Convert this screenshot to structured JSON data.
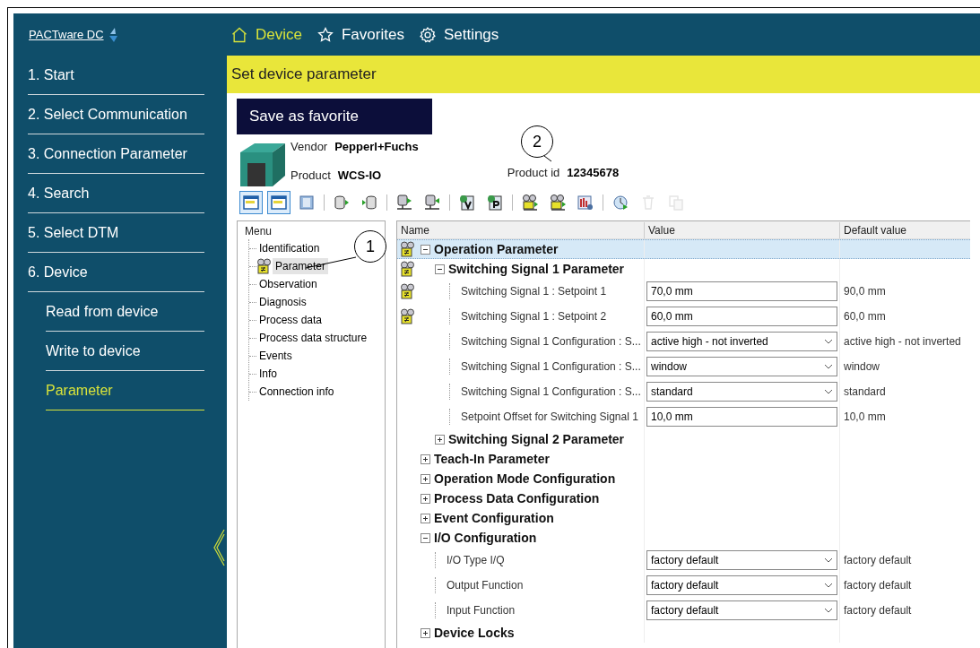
{
  "logo": {
    "text": "PACTware DC"
  },
  "top_nav": [
    {
      "kind": "home",
      "label": "Device",
      "selected": true
    },
    {
      "kind": "star",
      "label": "Favorites",
      "selected": false
    },
    {
      "kind": "gear",
      "label": "Settings",
      "selected": false
    }
  ],
  "sidebar": {
    "items": [
      {
        "label": "1. Start",
        "selected": false
      },
      {
        "label": "2. Select Communication",
        "selected": false
      },
      {
        "label": "3. Connection Parameter",
        "selected": false
      },
      {
        "label": "4. Search",
        "selected": false
      },
      {
        "label": "5. Select DTM",
        "selected": false
      },
      {
        "label": "6. Device",
        "selected": false,
        "children": [
          {
            "label": "Read from device",
            "selected": false
          },
          {
            "label": "Write to device",
            "selected": false
          },
          {
            "label": "Parameter",
            "selected": true
          }
        ]
      }
    ]
  },
  "page_title": "Set device parameter",
  "save_button": "Save as favorite",
  "device": {
    "vendor_label": "Vendor",
    "vendor": "Pepperl+Fuchs",
    "product_label": "Product",
    "product": "WCS-IO",
    "product_id_label": "Product id",
    "product_id": "12345678"
  },
  "toolbar": [
    {
      "kind": "window",
      "selected": true,
      "disabled": false
    },
    {
      "kind": "window",
      "selected": true,
      "disabled": false
    },
    {
      "kind": "panel",
      "selected": false,
      "disabled": false
    },
    {
      "kind": "separator"
    },
    {
      "kind": "db-out",
      "selected": false,
      "disabled": false
    },
    {
      "kind": "db-in",
      "selected": false,
      "disabled": false
    },
    {
      "kind": "separator"
    },
    {
      "kind": "device-out",
      "selected": false,
      "disabled": false
    },
    {
      "kind": "device-in",
      "selected": false,
      "disabled": false
    },
    {
      "kind": "separator"
    },
    {
      "kind": "doc-v",
      "selected": false,
      "disabled": false
    },
    {
      "kind": "doc-p",
      "selected": false,
      "disabled": false
    },
    {
      "kind": "separator"
    },
    {
      "kind": "device-check",
      "selected": false,
      "disabled": false
    },
    {
      "kind": "device-diff",
      "selected": false,
      "disabled": false
    },
    {
      "kind": "chart",
      "selected": false,
      "disabled": false
    },
    {
      "kind": "separator"
    },
    {
      "kind": "clock",
      "selected": false,
      "disabled": false
    },
    {
      "kind": "trash",
      "selected": false,
      "disabled": true
    },
    {
      "kind": "copy",
      "selected": false,
      "disabled": true
    }
  ],
  "menu": {
    "title": "Menu",
    "items": [
      {
        "label": "Identification",
        "selected": false,
        "changed": false
      },
      {
        "label": "Parameter",
        "selected": true,
        "changed": true
      },
      {
        "label": "Observation",
        "selected": false,
        "changed": false
      },
      {
        "label": "Diagnosis",
        "selected": false,
        "changed": false
      },
      {
        "label": "Process data",
        "selected": false,
        "changed": false
      },
      {
        "label": "Process data structure",
        "selected": false,
        "changed": false
      },
      {
        "label": "Events",
        "selected": false,
        "changed": false
      },
      {
        "label": "Info",
        "selected": false,
        "changed": false
      },
      {
        "label": "Connection info",
        "selected": false,
        "changed": false
      }
    ]
  },
  "table": {
    "columns": [
      "Name",
      "Value",
      "Default value"
    ],
    "rows": [
      {
        "kind": "group",
        "name": "Operation Parameter",
        "expanded": true,
        "selected": true,
        "changed": true,
        "children": [
          {
            "kind": "group",
            "name": "Switching Signal 1 Parameter",
            "expanded": true,
            "selected": false,
            "changed": true,
            "children": [
              {
                "kind": "text",
                "name": "Switching Signal 1 : Setpoint 1",
                "value": "70,0 mm",
                "default": "90,0 mm",
                "selected": false,
                "changed": true
              },
              {
                "kind": "text",
                "name": "Switching Signal 1 : Setpoint 2",
                "value": "60,0 mm",
                "default": "60,0 mm",
                "selected": false,
                "changed": true
              },
              {
                "kind": "select",
                "name": "Switching Signal 1 Configuration : S...",
                "value": "active high - not inverted",
                "default": "active high - not inverted",
                "selected": false,
                "changed": false
              },
              {
                "kind": "select",
                "name": "Switching Signal 1 Configuration : S...",
                "value": "window",
                "default": "window",
                "selected": false,
                "changed": false
              },
              {
                "kind": "select",
                "name": "Switching Signal 1 Configuration : S...",
                "value": "standard",
                "default": "standard",
                "selected": false,
                "changed": false
              },
              {
                "kind": "text",
                "name": "Setpoint Offset for Switching Signal 1",
                "value": "10,0 mm",
                "default": "10,0 mm",
                "selected": false,
                "changed": false
              }
            ]
          },
          {
            "kind": "group",
            "name": "Switching Signal 2 Parameter",
            "expanded": false,
            "selected": false,
            "changed": false
          }
        ]
      },
      {
        "kind": "group",
        "name": "Teach-In Parameter",
        "expanded": false,
        "selected": false,
        "changed": false
      },
      {
        "kind": "group",
        "name": "Operation Mode Configuration",
        "expanded": false,
        "selected": false,
        "changed": false
      },
      {
        "kind": "group",
        "name": "Process Data Configuration",
        "expanded": false,
        "selected": false,
        "changed": false
      },
      {
        "kind": "group",
        "name": "Event Configuration",
        "expanded": false,
        "selected": false,
        "changed": false
      },
      {
        "kind": "group",
        "name": "I/O Configuration",
        "expanded": true,
        "selected": false,
        "changed": false,
        "children": [
          {
            "kind": "select",
            "name": "I/O Type I/Q",
            "value": "factory default",
            "default": "factory default",
            "selected": false,
            "changed": false
          },
          {
            "kind": "select",
            "name": "Output Function",
            "value": "factory default",
            "default": "factory default",
            "selected": false,
            "changed": false
          },
          {
            "kind": "select",
            "name": "Input Function",
            "value": "factory default",
            "default": "factory default",
            "selected": false,
            "changed": false
          }
        ]
      },
      {
        "kind": "group",
        "name": "Device Locks",
        "expanded": false,
        "selected": false,
        "changed": false
      }
    ]
  },
  "callouts": [
    {
      "label": "1"
    },
    {
      "label": "2"
    }
  ]
}
